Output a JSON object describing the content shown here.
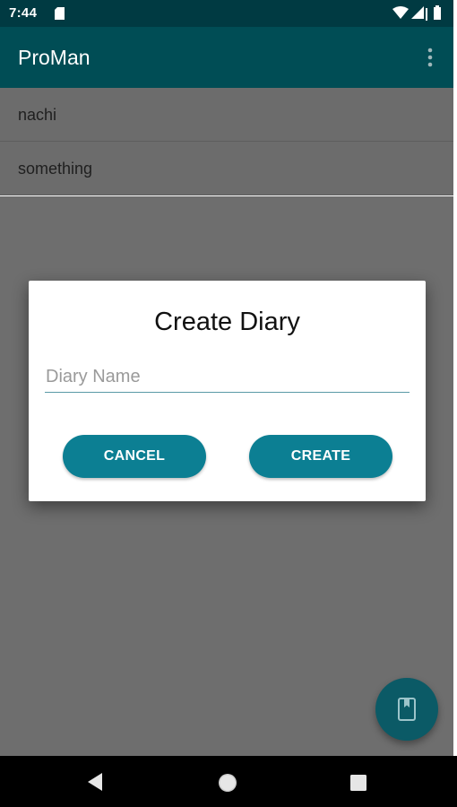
{
  "status_bar": {
    "time": "7:44",
    "icons": [
      "sd-card-icon",
      "wifi-icon",
      "signal-icon",
      "battery-icon"
    ]
  },
  "app_bar": {
    "title": "ProMan",
    "menu_icon": "overflow-menu-icon"
  },
  "list": {
    "items": [
      {
        "label": "nachi"
      },
      {
        "label": "something"
      }
    ]
  },
  "dialog": {
    "title": "Create Diary",
    "input": {
      "value": "",
      "placeholder": "Diary Name"
    },
    "cancel_label": "CANCEL",
    "create_label": "CREATE"
  },
  "fab": {
    "icon": "book-icon"
  },
  "nav_bar": {
    "icons": [
      "back-icon",
      "home-icon",
      "recents-icon"
    ]
  },
  "colors": {
    "status_bar": "#003a42",
    "app_bar": "#004d55",
    "scrim": "#6c6c6c",
    "button": "#0c7f93",
    "fab": "#0b5a66"
  }
}
